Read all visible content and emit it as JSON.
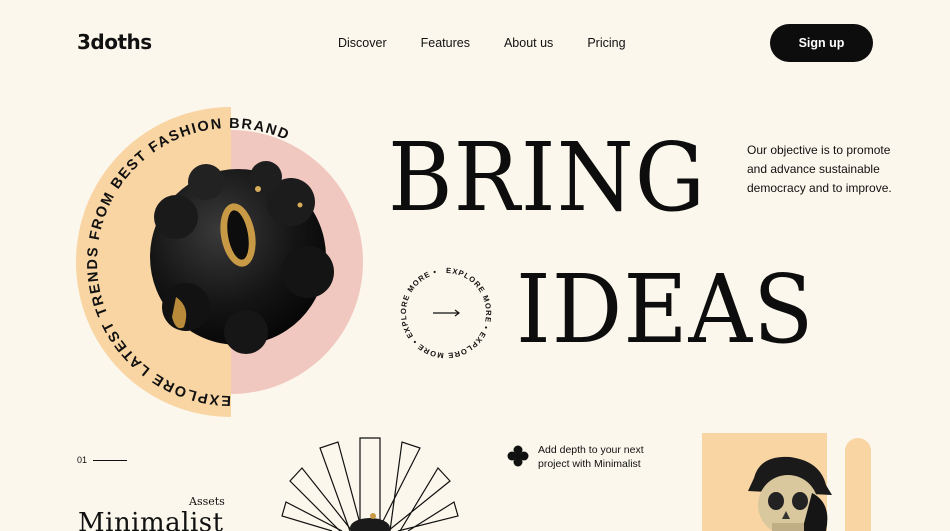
{
  "brand": {
    "name": "3doths"
  },
  "nav": {
    "items": [
      "Discover",
      "Features",
      "About us",
      "Pricing"
    ]
  },
  "header": {
    "signup_label": "Sign up"
  },
  "hero": {
    "circle_text": "EXPLORE LATEST TRENDS FROM BEST FASHION BRAND",
    "headline_line1": "BRING",
    "headline_line2": "IDEAS",
    "objective": "Our objective is to promote and advance sustainable democracy and to improve.",
    "explore_text": "EXPLORE MORE • EXPLORE MORE • EXPLORE MORE •"
  },
  "section": {
    "number": "01",
    "assets_label": "Assets",
    "title": "Minimalist",
    "depth_text": "Add depth to your next project with Minimalist"
  },
  "colors": {
    "background": "#fcf7ec",
    "peach": "#f8d5a3",
    "pink": "#f1c8c0",
    "dark": "#0d0d0d"
  },
  "icons": {
    "arrow": "arrow-right-icon",
    "clover": "clover-icon"
  }
}
